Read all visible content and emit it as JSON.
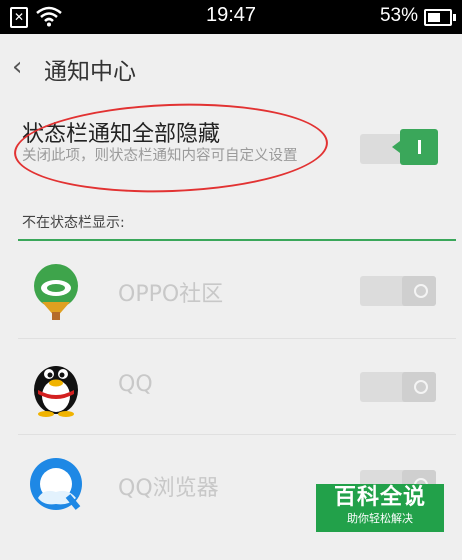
{
  "status_bar": {
    "time": "19:47",
    "battery": "53%",
    "sim_icon": "sim-icon",
    "wifi_icon": "wifi-icon"
  },
  "header": {
    "back_icon": "chevron-left-icon",
    "title": "通知中心"
  },
  "main_setting": {
    "title": "状态栏通知全部隐藏",
    "subtitle": "关闭此项，则状态栏通知内容可自定义设置",
    "enabled": true
  },
  "section": {
    "label": "不在状态栏显示:"
  },
  "apps": [
    {
      "name": "OPPO社区",
      "icon": "oppo-community-icon",
      "enabled": false
    },
    {
      "name": "QQ",
      "icon": "qq-penguin-icon",
      "enabled": false
    },
    {
      "name": "QQ浏览器",
      "icon": "qq-browser-icon",
      "enabled": false
    }
  ],
  "watermark": {
    "title": "百科全说",
    "subtitle": "助你轻松解决"
  },
  "colors": {
    "accent": "#3aa75a",
    "annotation": "#e23232"
  }
}
